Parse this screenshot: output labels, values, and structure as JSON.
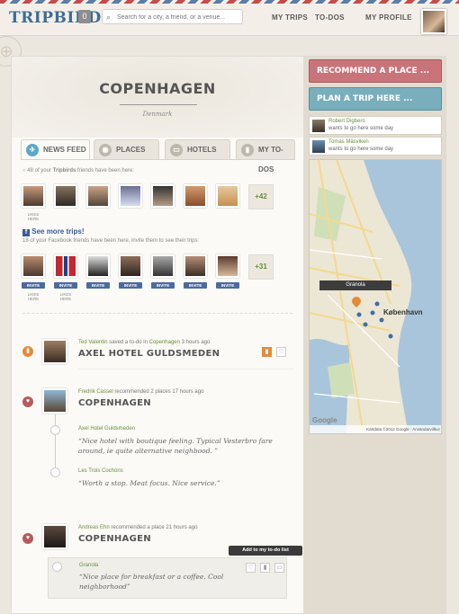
{
  "header": {
    "logo": "TRIPBIRDS",
    "notif_count": "0",
    "search_placeholder": "Search for a city, a friend, or a venue...",
    "nav": [
      "MY TRIPS",
      "TO-DOS",
      "MY PROFILE"
    ]
  },
  "hero": {
    "city": "COPENHAGEN",
    "country": "Denmark"
  },
  "tabs": [
    "NEWS FEED",
    "PLACES",
    "HOTELS",
    "MY TO-DOS"
  ],
  "friends": {
    "note_prefix": "48 of your",
    "note_brand": "Tripbirds",
    "note_suffix": "friends have been here:",
    "thumb_label": "LIKES HERE",
    "more": "+42",
    "fb_title": "See more trips!",
    "fb_note": "18 of your Facebook friends have been here, invite them to see their trips:",
    "invite": "INVITE",
    "fb_more": "+31"
  },
  "feed": [
    {
      "user": "Ted Valentin",
      "action": " saved a to-do in ",
      "place_link": "Copenhagen",
      "time": " 3 hours ago",
      "title": "AXEL HOTEL GULDSMEDEN"
    },
    {
      "user": "Fredrik Cassel",
      "action": " recommended 2 places ",
      "time": "17 hours ago",
      "title": "COPENHAGEN",
      "items": [
        {
          "name": "Axel Hotel Guldsmeden",
          "quote": "“Nice hotel with boutique feeling. Typical Vesterbro fare around, ie quite alternative neighbood. ”"
        },
        {
          "name": "Les Trois Cochons",
          "quote": "“Worth a stop. Meat focus. Nice service.”"
        }
      ]
    },
    {
      "user": "Andreas Ehn",
      "action": " recommended a place ",
      "time": "21 hours ago",
      "title": "COPENHAGEN",
      "items": [
        {
          "name": "Granola",
          "quote": "“Nice place for breakfast or a coffee. Cool neighborhood”"
        }
      ]
    }
  ],
  "tooltip": "Add to my to-do list",
  "sidebar": {
    "recommend": "RECOMMEND A PLACE ...",
    "plan": "PLAN A TRIP HERE ...",
    "activity": [
      {
        "name": "Robert Digbero",
        "text": "wants to go here some day"
      },
      {
        "name": "Tomas Mäsviken",
        "text": "wants to go here some day"
      }
    ],
    "map": {
      "pin_label": "Granola",
      "city_label": "København",
      "google": "Google",
      "footer": "Kartdata ©2012 Google · Användarvillkor"
    }
  },
  "colors": {
    "accent_orange": "#e58a3a",
    "green": "#6b8e3d",
    "red_btn": "#c9747a",
    "blue_btn": "#79aebd"
  }
}
